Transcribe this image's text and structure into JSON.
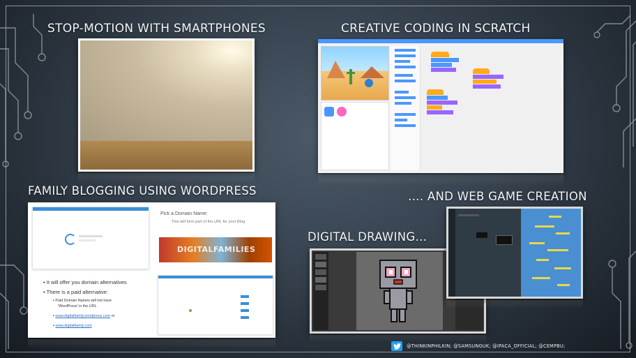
{
  "headings": {
    "stop_motion": "STOP-MOTION WITH SMARTPHONES",
    "scratch": "CREATIVE CODING IN SCRATCH",
    "wordpress": "FAMILY BLOGGING USING WORDPRESS",
    "web_game": "…. AND WEB GAME CREATION",
    "drawing": "DIGITAL DRAWING…"
  },
  "wordpress": {
    "domain_title": "Pick a Domain Name:",
    "domain_sub": "This will form part of the URL for your Blog",
    "banner": "DIGITALFAMILIES",
    "bullet1": "It will offer you domain alternatives",
    "bullet2": "There is a paid alternative:",
    "sub1": "Paid Domain Names will not have",
    "sub1b": "'WordPress' in the URL",
    "link1": "www.digitalfamily.wordpress.com",
    "link1_suffix": "or",
    "link2": "www.digitalfamily.com"
  },
  "credits": {
    "text": "@THINKINPHILKIN; @SAMSUNGUK; @IPACA_OFFICIAL; @CEMPBU;"
  },
  "colors": {
    "scratch_blue": "#4c97ff",
    "scratch_orange": "#ffab19",
    "scratch_purple": "#9966ff",
    "twitter": "#1da1f2"
  }
}
